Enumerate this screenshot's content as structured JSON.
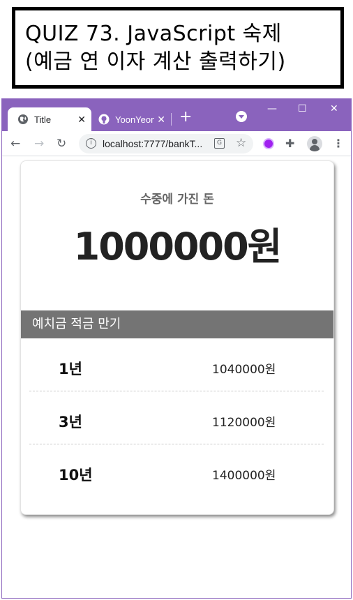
{
  "banner": {
    "line1": "QUIZ 73. JavaScript 숙제",
    "line2": "(예금 연 이자 계산 출력하기)"
  },
  "browser": {
    "tabs": [
      {
        "title": "Title",
        "icon": "globe-icon"
      },
      {
        "title": "YoonYeon",
        "icon": "github-icon"
      }
    ],
    "new_tab": "+",
    "url": "localhost:7777/bankT...",
    "window_buttons": {
      "minimize": "—",
      "maximize": "☐",
      "close": "✕"
    },
    "accent": "#8a63bd"
  },
  "page": {
    "cash_label": "수중에 가진 돈",
    "cash_amount": "1000000원",
    "section_header": "예치금 적금 만기",
    "rows": [
      {
        "term": "1년",
        "amount": "1040000원"
      },
      {
        "term": "3년",
        "amount": "1120000원"
      },
      {
        "term": "10년",
        "amount": "1400000원"
      }
    ],
    "header_color": "#747474"
  }
}
